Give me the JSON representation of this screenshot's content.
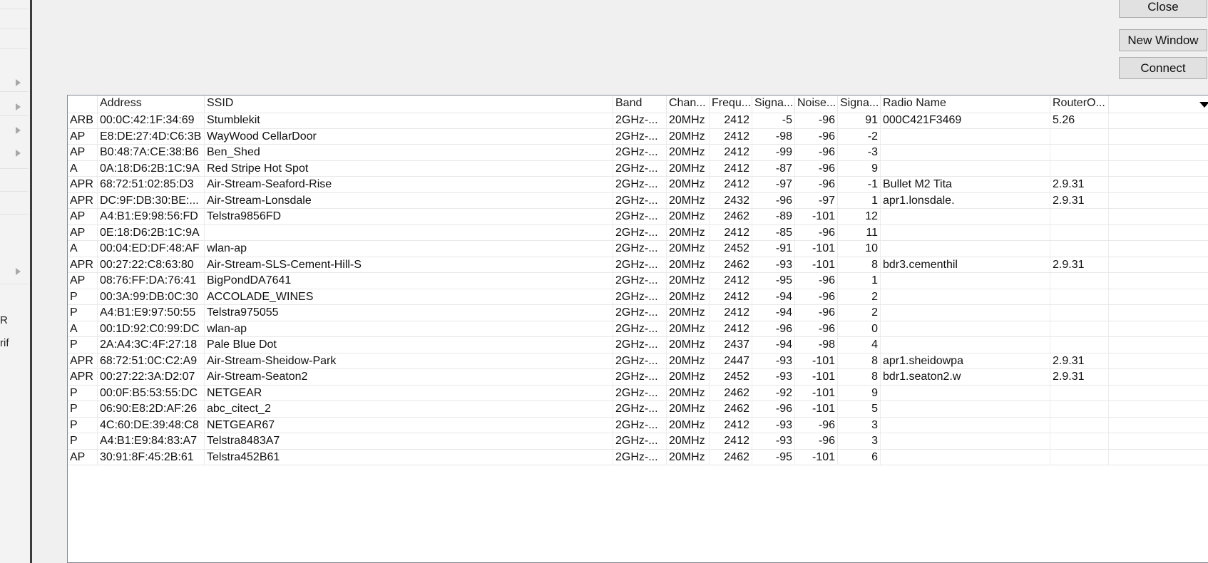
{
  "left_panel": {
    "stub_texts": [
      "R",
      "rif"
    ]
  },
  "buttons": {
    "close": "Close",
    "new_window": "New Window",
    "connect": "Connect"
  },
  "table": {
    "columns": [
      "",
      "Address",
      "SSID",
      "Band",
      "Chan...",
      "Frequ...",
      "Signa...",
      "Noise...",
      "Signa...",
      "Radio Name",
      "RouterO...",
      ""
    ],
    "rows": [
      [
        "ARB",
        "00:0C:42:1F:34:69",
        "Stumblekit",
        "2GHz-...",
        "20MHz",
        "2412",
        "-5",
        "-96",
        "91",
        "000C421F3469",
        "5.26"
      ],
      [
        "AP",
        "E8:DE:27:4D:C6:3B",
        "WayWood  CellarDoor",
        "2GHz-...",
        "20MHz",
        "2412",
        "-98",
        "-96",
        "-2",
        "",
        ""
      ],
      [
        "AP",
        "B0:48:7A:CE:38:B6",
        "Ben_Shed",
        "2GHz-...",
        "20MHz",
        "2412",
        "-99",
        "-96",
        "-3",
        "",
        ""
      ],
      [
        "A",
        "0A:18:D6:2B:1C:9A",
        "Red Stripe Hot Spot",
        "2GHz-...",
        "20MHz",
        "2412",
        "-87",
        "-96",
        "9",
        "",
        ""
      ],
      [
        "APR",
        "68:72:51:02:85:D3",
        "Air-Stream-Seaford-Rise",
        "2GHz-...",
        "20MHz",
        "2412",
        "-97",
        "-96",
        "-1",
        "Bullet M2 Tita",
        "2.9.31"
      ],
      [
        "APR",
        "DC:9F:DB:30:BE:...",
        "Air-Stream-Lonsdale",
        "2GHz-...",
        "20MHz",
        "2432",
        "-96",
        "-97",
        "1",
        "apr1.lonsdale.",
        "2.9.31"
      ],
      [
        "AP",
        "A4:B1:E9:98:56:FD",
        "Telstra9856FD",
        "2GHz-...",
        "20MHz",
        "2462",
        "-89",
        "-101",
        "12",
        "",
        ""
      ],
      [
        "AP",
        "0E:18:D6:2B:1C:9A",
        "",
        "2GHz-...",
        "20MHz",
        "2412",
        "-85",
        "-96",
        "11",
        "",
        ""
      ],
      [
        "A",
        "00:04:ED:DF:48:AF",
        "wlan-ap",
        "2GHz-...",
        "20MHz",
        "2452",
        "-91",
        "-101",
        "10",
        "",
        ""
      ],
      [
        "APR",
        "00:27:22:C8:63:80",
        "Air-Stream-SLS-Cement-Hill-S",
        "2GHz-...",
        "20MHz",
        "2462",
        "-93",
        "-101",
        "8",
        "bdr3.cementhil",
        "2.9.31"
      ],
      [
        "AP",
        "08:76:FF:DA:76:41",
        "BigPondDA7641",
        "2GHz-...",
        "20MHz",
        "2412",
        "-95",
        "-96",
        "1",
        "",
        ""
      ],
      [
        "P",
        "00:3A:99:DB:0C:30",
        "ACCOLADE_WINES",
        "2GHz-...",
        "20MHz",
        "2412",
        "-94",
        "-96",
        "2",
        "",
        ""
      ],
      [
        "P",
        "A4:B1:E9:97:50:55",
        "Telstra975055",
        "2GHz-...",
        "20MHz",
        "2412",
        "-94",
        "-96",
        "2",
        "",
        ""
      ],
      [
        "A",
        "00:1D:92:C0:99:DC",
        "wlan-ap",
        "2GHz-...",
        "20MHz",
        "2412",
        "-96",
        "-96",
        "0",
        "",
        ""
      ],
      [
        "P",
        "2A:A4:3C:4F:27:18",
        "Pale Blue Dot",
        "2GHz-...",
        "20MHz",
        "2437",
        "-94",
        "-98",
        "4",
        "",
        ""
      ],
      [
        "APR",
        "68:72:51:0C:C2:A9",
        "Air-Stream-Sheidow-Park",
        "2GHz-...",
        "20MHz",
        "2447",
        "-93",
        "-101",
        "8",
        "apr1.sheidowpa",
        "2.9.31"
      ],
      [
        "APR",
        "00:27:22:3A:D2:07",
        "Air-Stream-Seaton2",
        "2GHz-...",
        "20MHz",
        "2452",
        "-93",
        "-101",
        "8",
        "bdr1.seaton2.w",
        "2.9.31"
      ],
      [
        "P",
        "00:0F:B5:53:55:DC",
        "NETGEAR",
        "2GHz-...",
        "20MHz",
        "2462",
        "-92",
        "-101",
        "9",
        "",
        ""
      ],
      [
        "P",
        "06:90:E8:2D:AF:26",
        "abc_citect_2",
        "2GHz-...",
        "20MHz",
        "2462",
        "-96",
        "-101",
        "5",
        "",
        ""
      ],
      [
        "P",
        "4C:60:DE:39:48:C8",
        "NETGEAR67",
        "2GHz-...",
        "20MHz",
        "2412",
        "-93",
        "-96",
        "3",
        "",
        ""
      ],
      [
        "P",
        "A4:B1:E9:84:83:A7",
        "Telstra8483A7",
        "2GHz-...",
        "20MHz",
        "2412",
        "-93",
        "-96",
        "3",
        "",
        ""
      ],
      [
        "AP",
        "30:91:8F:45:2B:61",
        "Telstra452B61",
        "2GHz-...",
        "20MHz",
        "2462",
        "-95",
        "-101",
        "6",
        "",
        ""
      ]
    ]
  }
}
